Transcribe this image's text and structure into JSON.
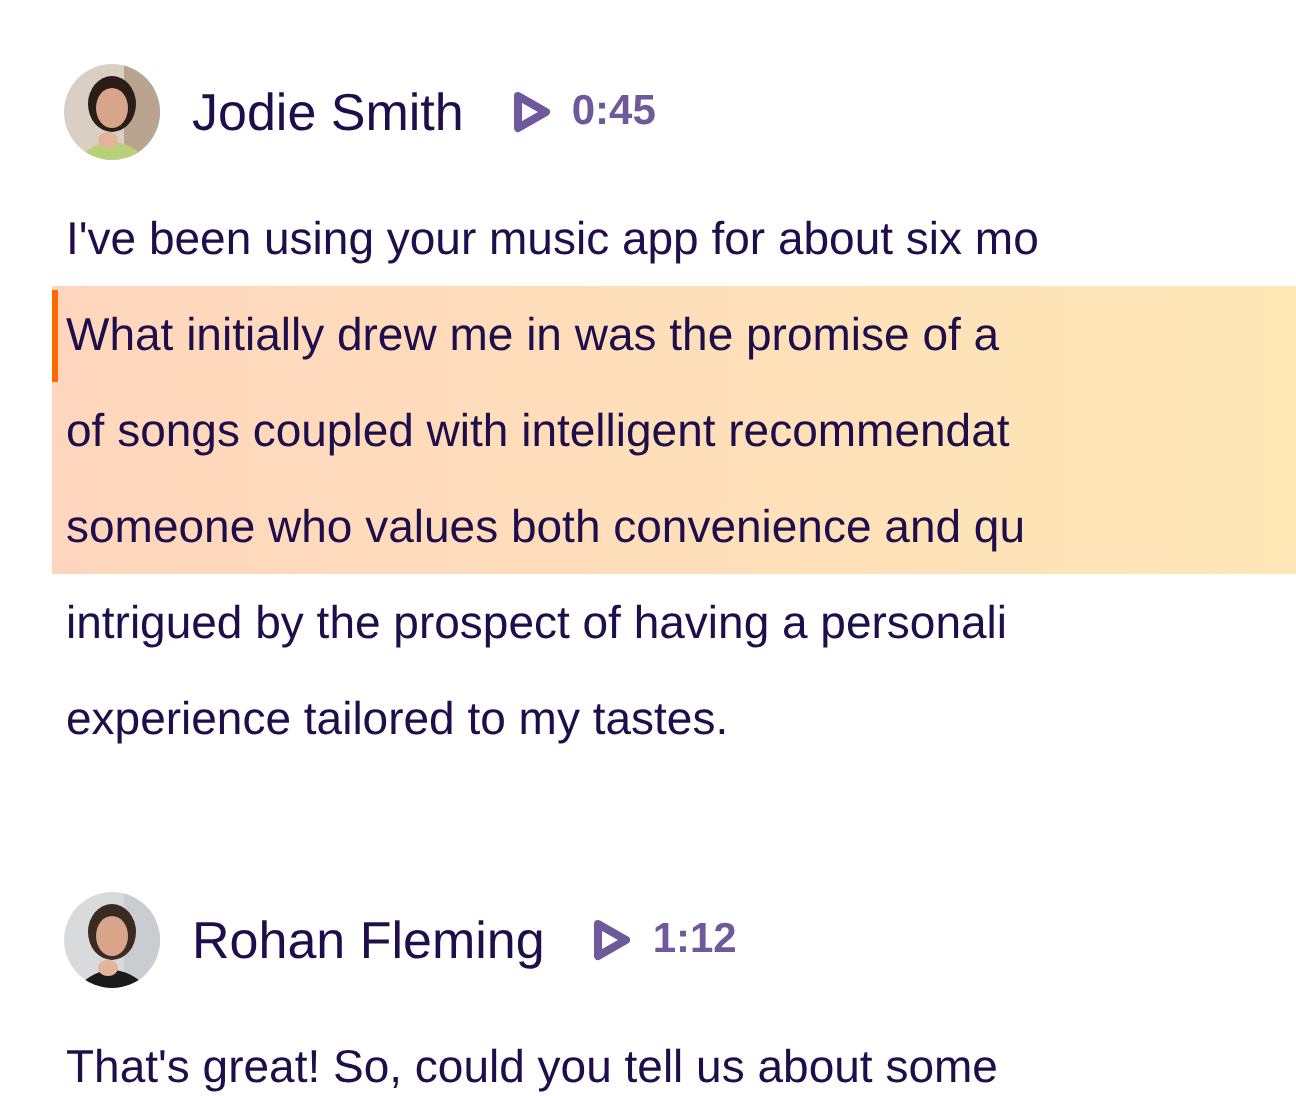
{
  "messages": [
    {
      "speaker": "Jodie Smith",
      "duration": "0:45",
      "lines": [
        {
          "text": "I've been using your music app for about six mo",
          "highlighted": false,
          "marked": false
        },
        {
          "text": "What initially drew me in was the promise of a",
          "highlighted": true,
          "marked": true
        },
        {
          "text": "of songs coupled with intelligent recommendat",
          "highlighted": true,
          "marked": false
        },
        {
          "text": "someone who values both convenience and qu",
          "highlighted": true,
          "marked": false
        },
        {
          "text": "intrigued by the prospect of having a personali",
          "highlighted": false,
          "marked": false
        },
        {
          "text": "experience tailored to my tastes.",
          "highlighted": false,
          "marked": false
        }
      ]
    },
    {
      "speaker": "Rohan Fleming",
      "duration": "1:12",
      "lines": [
        {
          "text": "That's great! So, could you tell us about some",
          "highlighted": false,
          "marked": false
        }
      ]
    }
  ]
}
